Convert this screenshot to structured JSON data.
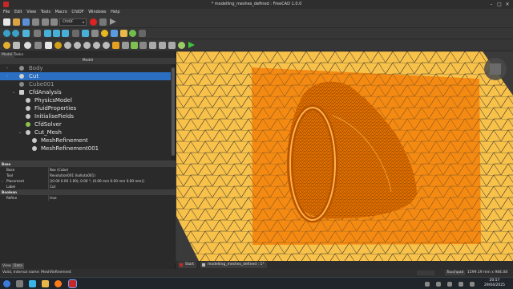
{
  "window": {
    "title": "* modelling_meshes_defined : FreeCAD 1.0.0",
    "controls": [
      "–",
      "□",
      "✕"
    ]
  },
  "menu": [
    "File",
    "Edit",
    "View",
    "Tools",
    "Macro",
    "CfdOF",
    "Windows",
    "Help"
  ],
  "workbench": {
    "selected": "CfdOF"
  },
  "panel": {
    "tabs": [
      "Model",
      "Tasks"
    ],
    "header": "Model",
    "tree": [
      {
        "label": "Body",
        "state": "dim",
        "expand": "›"
      },
      {
        "label": "Cut",
        "state": "selected",
        "expand": "›"
      },
      {
        "label": "Cube001",
        "state": "dim",
        "expand": ""
      },
      {
        "label": "CfdAnalysis",
        "state": "normal",
        "expand": "⌄"
      },
      {
        "label": "PhysicsModel",
        "state": "normal",
        "expand": ""
      },
      {
        "label": "FluidProperties",
        "state": "normal",
        "expand": ""
      },
      {
        "label": "InitialiseFields",
        "state": "normal",
        "expand": ""
      },
      {
        "label": "CfdSolver",
        "state": "normal",
        "expand": ""
      },
      {
        "label": "Cut_Mesh",
        "state": "normal",
        "expand": "⌄"
      },
      {
        "label": "MeshRefinement",
        "state": "normal",
        "expand": ""
      },
      {
        "label": "MeshRefinement001",
        "state": "normal",
        "expand": ""
      }
    ],
    "properties": [
      {
        "type": "group",
        "key": "Base"
      },
      {
        "type": "row",
        "key": "Base",
        "value": "Box (Cube)"
      },
      {
        "type": "row",
        "key": "Tool",
        "value": "Revolution001 (kalluta001)"
      },
      {
        "type": "row",
        "key": "Placement",
        "value": "[(0.00 0.00 1.00); 0.00 °; (0.00 mm  0.00 mm  0.00 mm)]",
        "expand": "›"
      },
      {
        "type": "row",
        "key": "Label",
        "value": "Cut"
      },
      {
        "type": "group",
        "key": "Boolean"
      },
      {
        "type": "row",
        "key": "Refine",
        "value": "true"
      }
    ],
    "view_tabs": [
      "View",
      "Data"
    ]
  },
  "viewport_tabs": [
    "Start",
    "modelling_meshes_defined : 1*"
  ],
  "status": {
    "message": "Valid, Internal name: MeshRefinement",
    "navigation": "Touchpad",
    "dimensions": "1599.19 mm x 984.08 mm"
  },
  "clock": {
    "time": "20:57",
    "date": "29/04/2025"
  },
  "colors": {
    "mesh_yellow": "#f7c14a",
    "mesh_orange": "#f58a12",
    "selection": "#2a6fc2"
  }
}
